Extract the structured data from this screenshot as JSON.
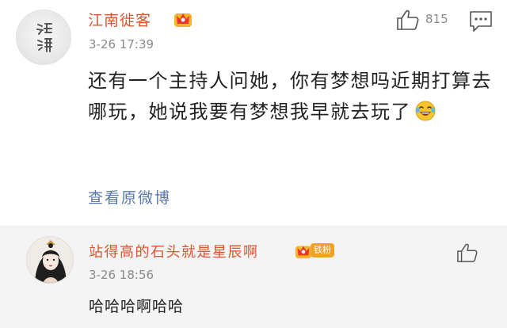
{
  "post": {
    "username": "江南徙客",
    "timestamp": "3-26 17:39",
    "like_count": "815",
    "body": "还有一个主持人问她，你有梦想吗近期打算去哪玩，她说我要有梦想我早就去玩了",
    "view_original": "查看原微博",
    "avatar_seal_text": "渊清"
  },
  "reply": {
    "username": "站得高的石头就是星辰啊",
    "fan_badge": "铁粉",
    "timestamp": "3-26 18:56",
    "text": "哈哈哈啊哈哈"
  },
  "icons": {
    "crown": "crown-badge-icon",
    "like": "thumbs-up-icon",
    "comment": "comment-icon",
    "emoji": "laughing-tears-emoji-icon"
  },
  "colors": {
    "username": "#d9552e",
    "link": "#5a77a8",
    "meta": "#8a8a8a",
    "reply_bg": "#f4f4f4",
    "badge": "#f0a12a"
  }
}
